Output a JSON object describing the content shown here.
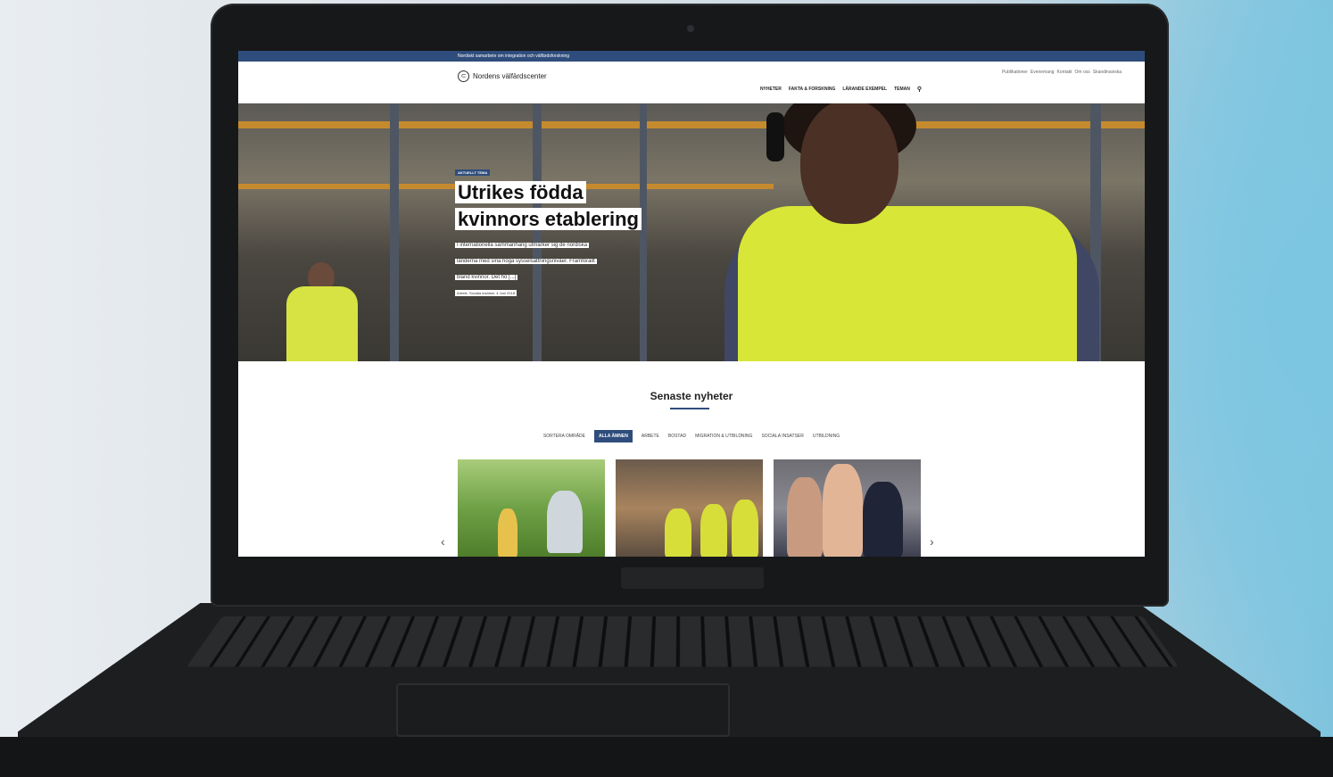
{
  "site": {
    "topbar_text": "Nordiskt samarbete om integration och välfärdsforskning",
    "logo_text": "Nordens välfärdscenter",
    "util_links": [
      "Publikationer",
      "Evenemang",
      "Kontakt",
      "Om oss",
      "Skandinaviska"
    ],
    "nav": [
      "NYHETER",
      "FAKTA & FORSKNING",
      "LÄRANDE EXEMPEL",
      "TEMAN"
    ]
  },
  "hero": {
    "tag": "AKTUELLT TEMA",
    "title": "Utrikes födda kvinnors etablering",
    "excerpt_lines": [
      "I internationella sammanhang utmärker sig de nordiska",
      "länderna med sina höga sysselsättningsnivåer. Framförallt",
      "bland kvinnor. Det hö [...]"
    ],
    "meta": "Arbete, Sociala insatser, 4 Juni 2018"
  },
  "news": {
    "heading": "Senaste nyheter",
    "filter_label": "SORTERA OMRÅDE",
    "filters": [
      "ALLA ÄMNEN",
      "ARBETE",
      "BOSTAD",
      "MIGRATION & UTBILDNING",
      "SOCIALA INSATSER",
      "UTBILDNING"
    ],
    "active_filter": "ALLA ÄMNEN"
  },
  "icons": {
    "search": "search-icon",
    "prev": "chevron-left-icon",
    "next": "chevron-right-icon"
  },
  "colors": {
    "brand": "#2f4d7c"
  }
}
